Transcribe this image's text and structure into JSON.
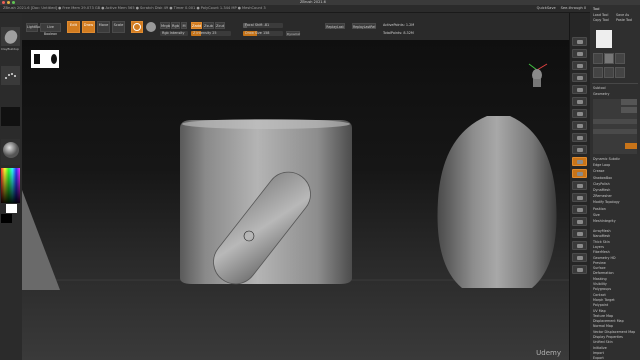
{
  "app": {
    "title": "ZBrush 2021.6",
    "doc_info": "ZBrush 2021.6  [Doc: Untitled]   ● Free Mem 29.073 GB  ● Active Mem 565  ● Scratch Disk 49  ● Timer 0.001  ● PolyCount 1.344 MP  ● MeshCount 3"
  },
  "menu": {
    "items": [
      "Alpha",
      "Brush",
      "Color",
      "Document",
      "Draw",
      "Dynamics",
      "Edit",
      "File",
      "Layer",
      "Light",
      "Macro",
      "Marker",
      "Material",
      "Movie",
      "Picker",
      "Preferences",
      "Render",
      "Stencil",
      "Stroke",
      "Texture",
      "Tool",
      "Transform",
      "Zplugin",
      "Zscript",
      "Help"
    ],
    "right_items": [
      "QuickSave",
      "See-through 0",
      "Menus",
      "DefaultZScript"
    ]
  },
  "toolbar": {
    "lightbox": "LightBox",
    "live_boolean": "Live Boolean",
    "edit": "Edit",
    "draw": "Draw",
    "move": "Move",
    "scale": "Scale",
    "rotate": "Rotate",
    "mrgb": "Mrgb",
    "rgb": "Rgb",
    "m": "M",
    "zadd": "Zadd",
    "zsub": "Zsub",
    "zcut": "Zcut",
    "rgb_intensity": "Rgb Intensity",
    "z_intensity": "Z Intensity 25",
    "focal_shift": "Focal Shift -81",
    "draw_size": "Draw Size 158",
    "dynamic": "Dynamic",
    "replay_last": "ReplayLast",
    "replay_last_rel": "ReplayLastRel",
    "active_points": "ActivePoints: 1.2M",
    "total_points": "TotalPoints: 8.32M"
  },
  "left_shelf": {
    "brush_label": "ClayBuildup",
    "stroke_label": "DragRect",
    "alpha_label": "Alpha Off",
    "material_label": "MatCap Gray"
  },
  "right_shelf": {
    "icons": [
      "bpr-icon",
      "spix-icon",
      "scroll-icon",
      "zoom-icon",
      "actual-icon",
      "aahalf-icon",
      "persp-icon",
      "floor-icon",
      "local-icon",
      "lsym-icon",
      "xyz-icon",
      "frame-icon",
      "move-icon",
      "zoom3d-icon",
      "rotate-icon",
      "polyf-icon",
      "transp-icon",
      "ghost-icon",
      "solo-icon",
      "xpose-icon"
    ]
  },
  "palette": {
    "header": "Tool",
    "load_tool": "Load Tool",
    "save_as": "Save As",
    "copy_tool": "Copy Tool",
    "paste_tool": "Paste Tool",
    "import": "Import",
    "export": "Export",
    "clone": "Clone",
    "make_polymesh": "Make PolyMesh3D",
    "goz": "GoZ",
    "all": "All",
    "visible": "Visible",
    "lightbox_tools": "Lightbox▸Tools",
    "current_tool": "PM3D_Cylinder3D_2  48",
    "subtool": "Subtool",
    "geometry": "Geometry",
    "items": [
      "ArrayMesh",
      "NanoMesh",
      "Thick Skin",
      "Layers",
      "FiberMesh",
      "Geometry HD",
      "Preview",
      "Surface",
      "Deformation",
      "Masking",
      "Visibility",
      "Polygroups",
      "Contact",
      "Morph Target",
      "Polypaint",
      "UV Map",
      "Texture Map",
      "Displacement Map",
      "Normal Map",
      "Vector Displacement Map",
      "Display Properties",
      "Unified Skin",
      "Initialize",
      "Import",
      "Export"
    ],
    "mid_items": [
      "Dynamic Subdiv",
      "Edge Loop",
      "Crease",
      "ShadowBox",
      "ClayPolish",
      "DynaMesh",
      "ZRemesher",
      "Modify Topology",
      "Position",
      "Size",
      "MeshIntegrity"
    ]
  },
  "watermark": "Udemy"
}
